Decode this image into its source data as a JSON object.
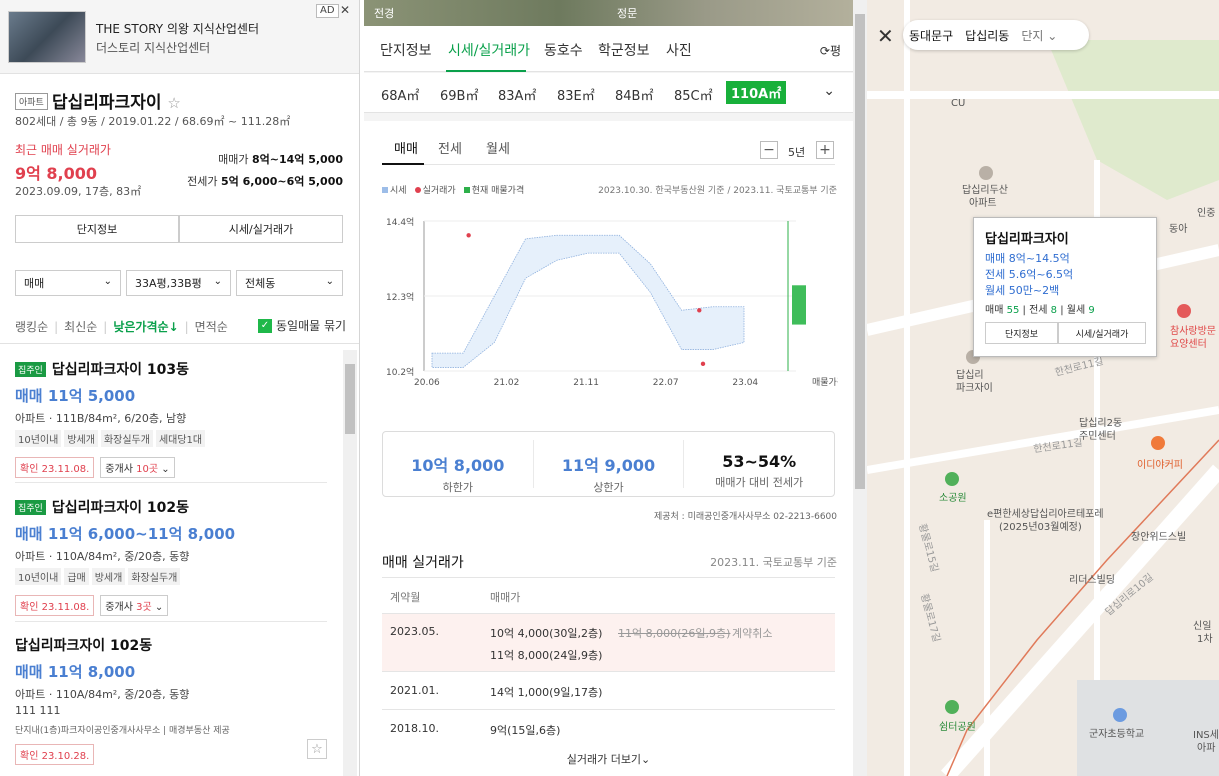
{
  "ad": {
    "badge": "AD",
    "close": "✕",
    "title": "THE STORY 의왕 지식산업센터",
    "subtitle": "더스토리 지식산업센터"
  },
  "complex": {
    "type": "아파트",
    "name": "답십리파크자이",
    "star": "☆",
    "meta": "802세대 / 총 9동 / 2019.01.22 / 68.69㎡ ~ 111.28㎡",
    "recent_label": "최근 매매 실거래가",
    "recent_price": "9억 8,000",
    "recent_date": "2023.09.09, 17층, 83㎡",
    "sale_label": "매매가",
    "sale_range": "8억~14억 5,000",
    "jeonse_label": "전세가",
    "jeonse_range": "5억 6,000~6억 5,000",
    "btn_info": "단지정보",
    "btn_price": "시세/실거래가"
  },
  "filters": {
    "deal": "매매",
    "area": "33A평,33B평",
    "dong": "전체동",
    "chev": "⌄"
  },
  "sort": {
    "items": [
      "랭킹순",
      "최신순",
      "낮은가격순↓",
      "면적순"
    ],
    "check_label": "동일매물 묶기",
    "check": "✓"
  },
  "listings": [
    {
      "owner": "집주인",
      "title": "답십리파크자이 103동",
      "price": "매매 11억 5,000",
      "info": "아파트 · 111B/84m², 6/20층, 남향",
      "tags": [
        "10년이내",
        "방세개",
        "화장실두개",
        "세대당1대"
      ],
      "confirm": "확인 23.11.08.",
      "agent": "중개사",
      "agent_count": "10곳",
      "chev": "⌄"
    },
    {
      "owner": "집주인",
      "title": "답십리파크자이 102동",
      "price": "매매 11억 6,000~11억 8,000",
      "info": "아파트 · 110A/84m², 중/20층, 동향",
      "tags": [
        "10년이내",
        "급매",
        "방세개",
        "화장실두개"
      ],
      "confirm": "확인 23.11.08.",
      "agent": "중개사",
      "agent_count": "3곳",
      "chev": "⌄"
    },
    {
      "title": "답십리파크자이 102동",
      "price": "매매 11억 8,000",
      "info": "아파트 · 110A/84m², 중/20층, 동향",
      "extra": "111 111",
      "provider": "단지내(1층)파크자이공인중개사사무소 | 매경부동산 제공",
      "confirm": "확인 23.10.28.",
      "star": "☆"
    }
  ],
  "mid": {
    "photo_left": "전경",
    "photo_right": "정문",
    "tabs": [
      "단지정보",
      "시세/실거래가",
      "동호수",
      "학군정보",
      "사진"
    ],
    "pyeong": "⟳평",
    "areas": [
      "68A㎡",
      "69B㎡",
      "83A㎡",
      "83E㎡",
      "84B㎡",
      "85C㎡",
      "110A㎡"
    ],
    "area_chev": "⌄",
    "subtabs": [
      "매매",
      "전세",
      "월세"
    ],
    "minus": "−",
    "plus": "+",
    "period": "5년",
    "legend": [
      "시세",
      "실거래가",
      "현재 매물가격"
    ],
    "source": "2023.10.30. 한국부동산원 기준 / 2023.11. 국토교통부 기준",
    "stats": [
      {
        "v": "10억 8,000",
        "l": "하한가"
      },
      {
        "v": "11억 9,000",
        "l": "상한가"
      },
      {
        "v": "53~54%",
        "l": "매매가 대비 전세가"
      }
    ],
    "provider": "제공처 : 미래공인중개사사무소 02-2213-6600",
    "trade_title": "매매 실거래가",
    "trade_src": "2023.11. 국토교통부 기준",
    "col_date": "계약월",
    "col_price": "매매가",
    "rows": [
      {
        "date": "2023.05.",
        "p1": "10억 4,000(30일,2층)",
        "cancel": "11억 8,000(26일,9층)",
        "cancel_lbl": "계약취소",
        "p2": "11억 8,000(24일,9층)"
      },
      {
        "date": "2021.01.",
        "p1": "14억 1,000(9일,17층)"
      },
      {
        "date": "2018.10.",
        "p1": "9억(15일,6층)"
      }
    ],
    "more": "실거래가 더보기⌄"
  },
  "chart_data": {
    "type": "line",
    "y_ticks": [
      "14.4억",
      "12.3억",
      "10.2억"
    ],
    "x_ticks": [
      "20.06",
      "21.02",
      "21.11",
      "22.07",
      "23.04",
      "매물가격"
    ],
    "ylim": [
      10.2,
      14.4
    ],
    "series": [
      {
        "name": "시세",
        "band_upper": [
          10.7,
          10.7,
          12.3,
          13.9,
          14.0,
          14.0,
          14.0,
          13.2,
          11.9,
          12.0,
          12.0
        ],
        "band_lower": [
          10.3,
          10.3,
          11.0,
          12.8,
          13.3,
          13.5,
          13.5,
          12.4,
          10.8,
          10.8,
          11.0
        ]
      },
      {
        "name": "실거래가",
        "points": [
          [
            0.12,
            14.0
          ],
          [
            0.74,
            11.9
          ],
          [
            0.75,
            10.4
          ]
        ]
      },
      {
        "name": "현재 매물가격",
        "range": [
          11.5,
          12.6
        ]
      }
    ]
  },
  "map": {
    "close": "✕",
    "crumbs": [
      "동대문구",
      "답십리동",
      "단지"
    ],
    "crumb_chev": "⌄",
    "pop": {
      "title": "답십리파크자이",
      "sale": "매매 8억~14.5억",
      "jeonse": "전세 5.6억~6.5억",
      "wolse": "월세 50만~2백",
      "c1": "매매",
      "n1": "55",
      "c2": "전세",
      "n2": "8",
      "c3": "월세",
      "n3": "9",
      "b1": "단지정보",
      "b2": "시세/실거래가"
    },
    "labels": [
      "CU",
      "답십리두산",
      "아파트",
      "답십리",
      "파크자이",
      "답십리2동",
      "주민센터",
      "이디야커피",
      "소공원",
      "e편한세상답십리아르테포레",
      "(2025년03월예정)",
      "장안위드스빌",
      "리더스빌딩",
      "쉼터공원",
      "군자초등학교",
      "참사랑방문",
      "요양센터",
      "한천로11길",
      "한천로11길",
      "답십리로10길",
      "황물로17길",
      "황물로15길",
      "동아",
      "인중",
      "신일",
      "1차",
      "INS세",
      "아파"
    ]
  }
}
